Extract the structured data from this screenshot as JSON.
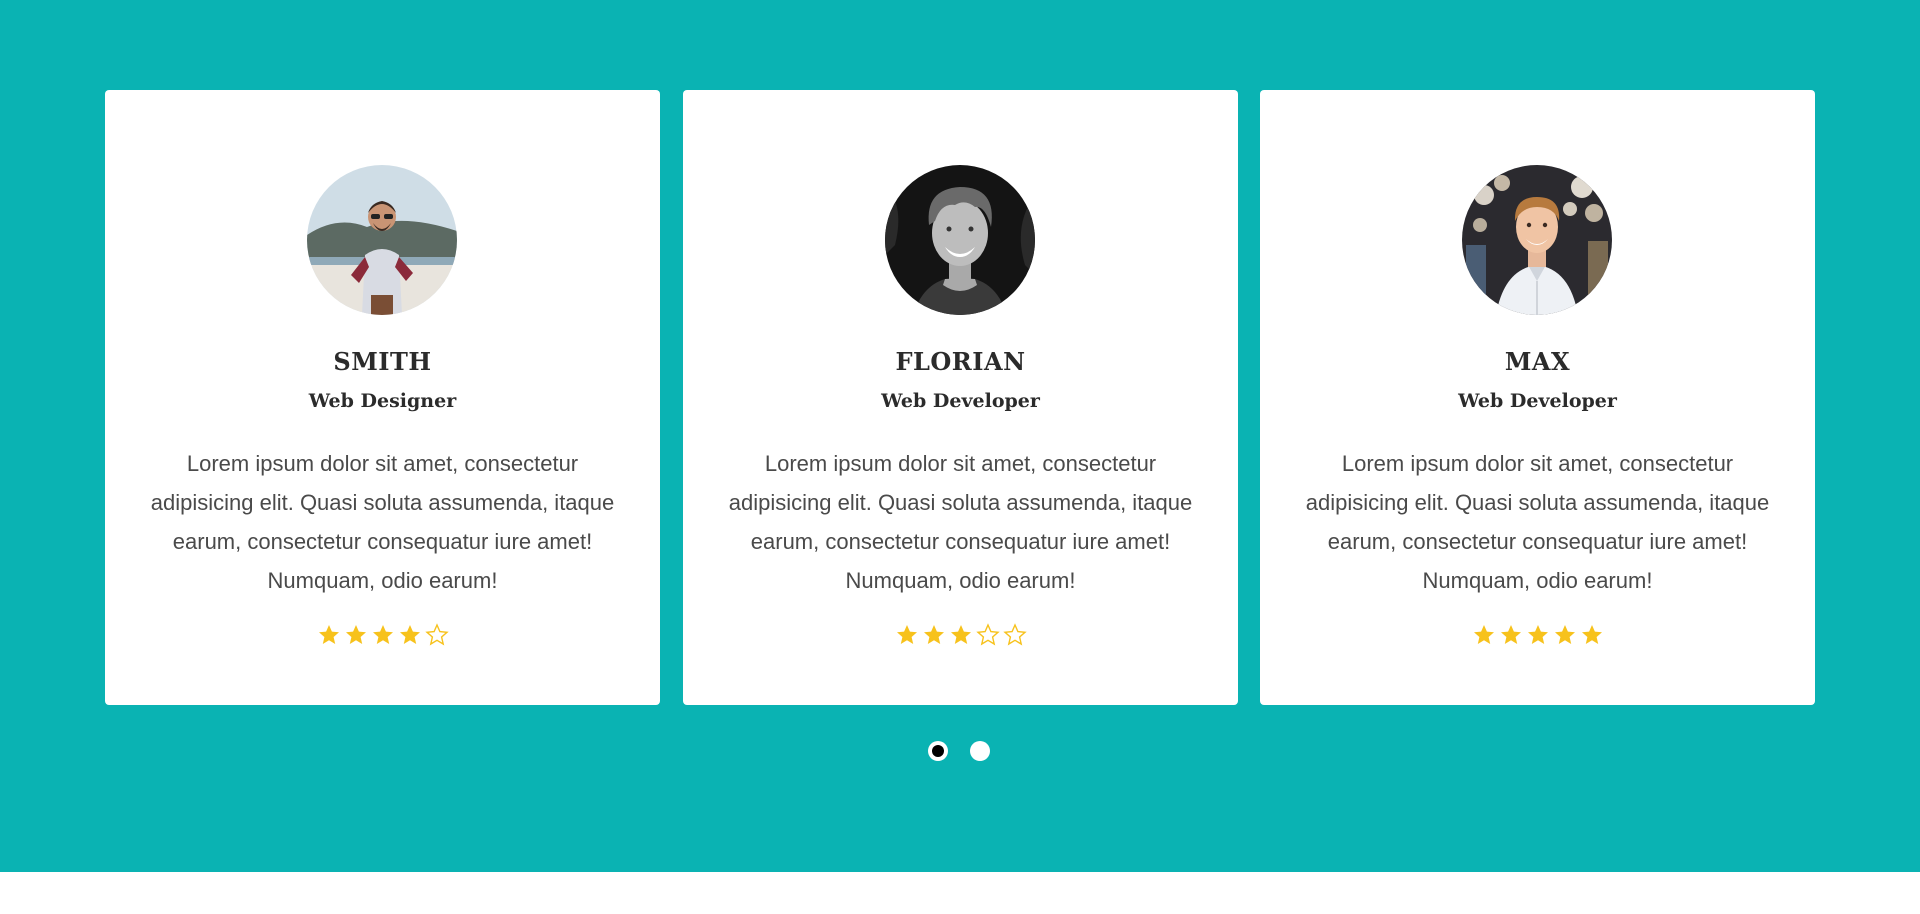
{
  "colors": {
    "background": "#0ab3b3",
    "card": "#ffffff",
    "star": "#f7c21c",
    "text": "#4a4a4a",
    "heading": "#2b2b2b"
  },
  "testimonials": [
    {
      "name": "SMITH",
      "role": "Web Designer",
      "text": "Lorem ipsum dolor sit amet, consectetur adipisicing elit. Quasi soluta assumenda, itaque earum, consectetur consequatur iure amet! Numquam, odio earum!",
      "rating": 4,
      "max_rating": 5,
      "avatar": "man-with-sunglasses-on-balcony"
    },
    {
      "name": "FLORIAN",
      "role": "Web Developer",
      "text": "Lorem ipsum dolor sit amet, consectetur adipisicing elit. Quasi soluta assumenda, itaque earum, consectetur consequatur iure amet! Numquam, odio earum!",
      "rating": 3,
      "max_rating": 5,
      "avatar": "smiling-man-black-and-white"
    },
    {
      "name": "MAX",
      "role": "Web Developer",
      "text": "Lorem ipsum dolor sit amet, consectetur adipisicing elit. Quasi soluta assumenda, itaque earum, consectetur consequatur iure amet! Numquam, odio earum!",
      "rating": 5,
      "max_rating": 5,
      "avatar": "man-in-white-shirt"
    }
  ],
  "pagination": {
    "pages": 2,
    "active": 1
  }
}
